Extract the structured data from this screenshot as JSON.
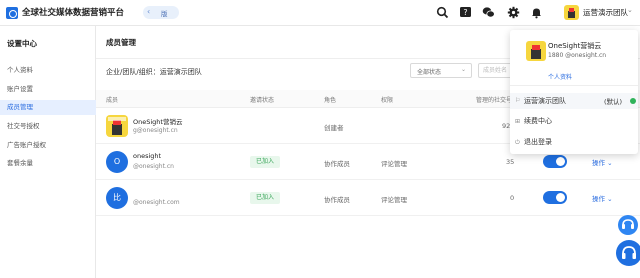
{
  "header": {
    "app_title": "全球社交媒体数据营销平台",
    "version_label": "版",
    "user_name": "运营演示团队",
    "icons": [
      "search-icon",
      "help-icon",
      "wechat-icon",
      "gear-icon",
      "bell-icon",
      "chevron-down-icon"
    ]
  },
  "sidebar": {
    "title": "设置中心",
    "items": [
      {
        "label": "个人资料",
        "active": false
      },
      {
        "label": "账户设置",
        "active": false
      },
      {
        "label": "成员管理",
        "active": true
      },
      {
        "label": "社交号授权",
        "active": false
      },
      {
        "label": "广告账户授权",
        "active": false
      },
      {
        "label": "套餐余量",
        "active": false
      }
    ]
  },
  "main": {
    "page_title": "成员管理",
    "filter_label": "企业/团队/组织：运营演示团队",
    "status_select": "全部状态",
    "search_placeholder": "成员姓名",
    "columns": [
      "成员",
      "邀请状态",
      "角色",
      "权限",
      "管理的社交号",
      "",
      "操作"
    ],
    "rows": [
      {
        "avatar_text": "",
        "name": "OneSight营销云",
        "email": "g@onesight.cn",
        "status": "",
        "role": "创建者",
        "permission": "",
        "count": "92",
        "action": ""
      },
      {
        "avatar_text": "O",
        "name": "onesight",
        "email": "@onesight.cn",
        "status": "已加入",
        "role": "协作成员",
        "permission": "评论管理",
        "count": "35",
        "action": "操作"
      },
      {
        "avatar_text": "比",
        "name": "",
        "email": "@onesight.com",
        "status": "已加入",
        "role": "协作成员",
        "permission": "评论管理",
        "count": "0",
        "action": "操作"
      }
    ]
  },
  "dropdown": {
    "name": "OneSight营销云",
    "sub": "1880  @onesight.cn",
    "profile_link": "个人资料",
    "team": "运营演示团队",
    "team_tag": "(默认)",
    "items": [
      "续费中心",
      "退出登录"
    ]
  },
  "colors": {
    "accent": "#1f6fe0",
    "active_bg": "#e6efff",
    "success": "#3aa65a"
  }
}
